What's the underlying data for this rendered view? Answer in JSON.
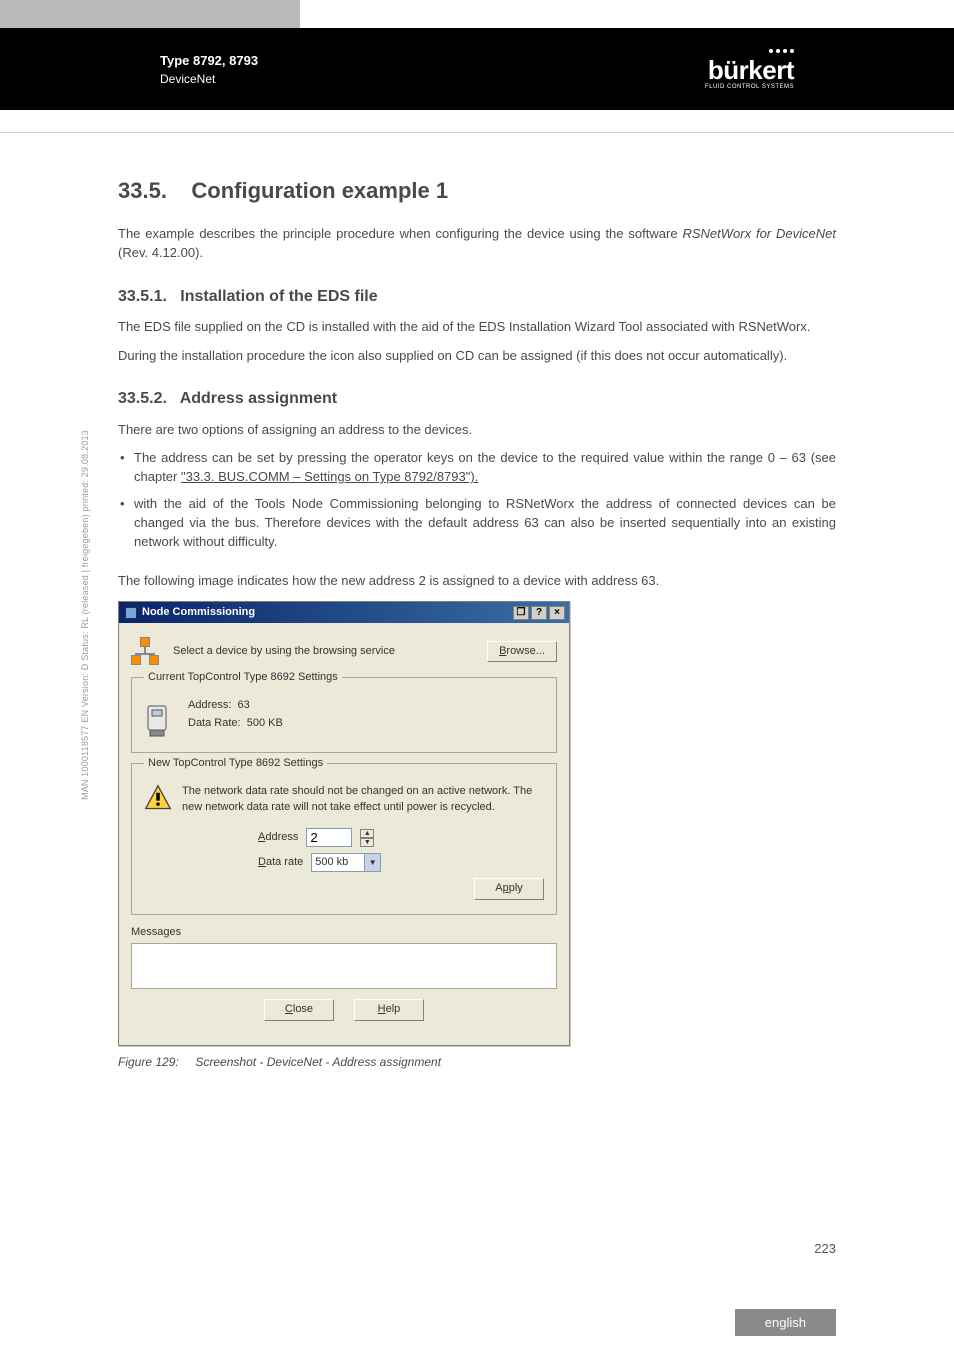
{
  "header": {
    "title": "Type 8792, 8793",
    "subtitle": "DeviceNet",
    "logo": "bürkert",
    "logo_sub": "FLUID CONTROL SYSTEMS"
  },
  "section": {
    "num": "33.5.",
    "title": "Configuration example 1",
    "intro_a": "The example describes the principle procedure when configuring the device using the software ",
    "intro_b": "RSNetWorx for DeviceNet",
    "intro_c": " (Rev. 4.12.00)."
  },
  "sub1": {
    "num": "33.5.1.",
    "title": "Installation of the EDS file",
    "p1": "The EDS file supplied on the CD is installed with the aid of the EDS Installation Wizard Tool associated with RSNetWorx.",
    "p2": "During the installation procedure the icon also supplied on CD can be assigned (if this does not occur automatically)."
  },
  "sub2": {
    "num": "33.5.2.",
    "title": "Address assignment",
    "p1": "There are two options of assigning an address to the devices.",
    "b1a": "The address can be set by pressing the operator keys on the device to the required value within the range 0 – 63 (see chapter ",
    "b1b": "\"33.3. BUS.COMM – Settings on Type 8792/8793\").",
    "b2": "with the aid of the Tools Node Commissioning belonging to RSNetWorx the address of connected devices can be changed via the bus. Therefore devices with the default address 63 can also be inserted sequentially into an existing network without difficulty.",
    "p2": "The following image indicates how the new address 2 is assigned to a device with address 63."
  },
  "dialog": {
    "title": "Node Commissioning",
    "select_text": "Select a device by using the browsing service",
    "browse": "Browse...",
    "current_legend": "Current TopControl Type 8692 Settings",
    "address_lbl": "Address:",
    "address_val": "63",
    "datarate_lbl": "Data Rate:",
    "datarate_val": "500 KB",
    "new_legend": "New TopControl Type 8692 Settings",
    "warning": "The network data rate should not be changed on an active network. The new network data rate will not take effect until power is recycled.",
    "addr_label": "Address",
    "addr_value": "2",
    "rate_label": "Data rate",
    "rate_value": "500 kb",
    "apply": "Apply",
    "messages": "Messages",
    "close": "Close",
    "help": "Help"
  },
  "caption": {
    "prefix": "Figure 129:",
    "text": "Screenshot - DeviceNet - Address assignment"
  },
  "side_note": "MAN 1000118577 EN Version: D Status: RL (released | freigegeben) printed: 29.08.2013",
  "page_number": "223",
  "language": "english"
}
